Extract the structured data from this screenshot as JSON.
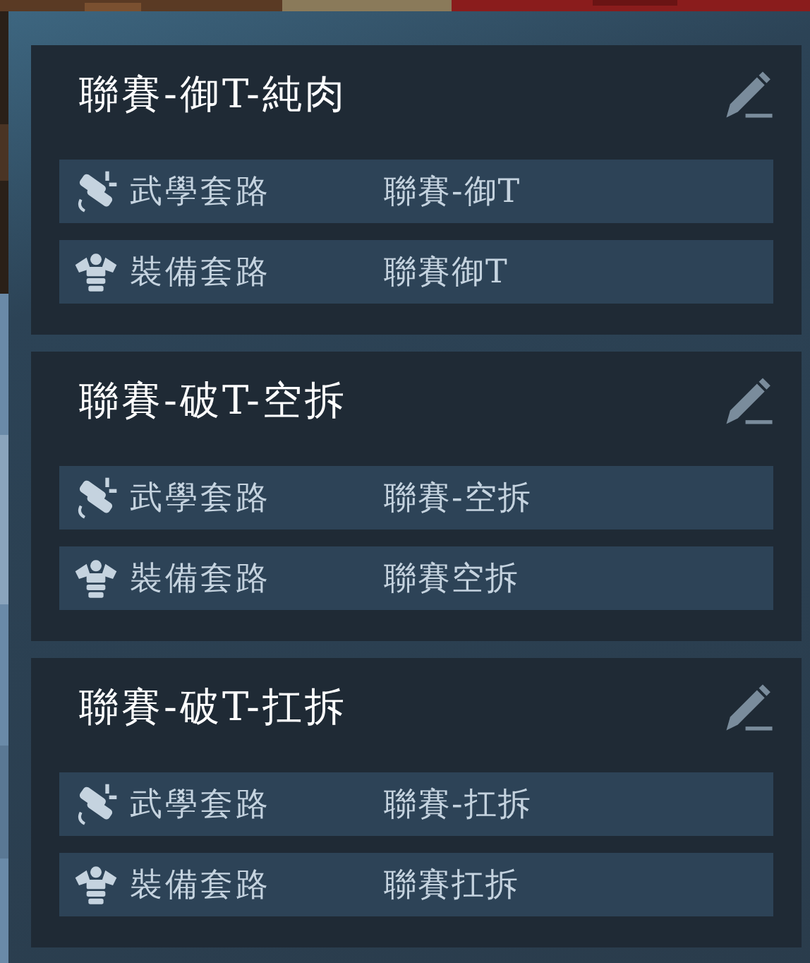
{
  "loadouts": [
    {
      "title": "聯賽-御T-純肉",
      "rows": [
        {
          "kind": "skills",
          "label": "武學套路",
          "value": "聯賽-御T"
        },
        {
          "kind": "gear",
          "label": "裝備套路",
          "value": "聯賽御T"
        }
      ]
    },
    {
      "title": "聯賽-破T-空拆",
      "rows": [
        {
          "kind": "skills",
          "label": "武學套路",
          "value": "聯賽-空拆"
        },
        {
          "kind": "gear",
          "label": "裝備套路",
          "value": "聯賽空拆"
        }
      ]
    },
    {
      "title": "聯賽-破T-扛拆",
      "rows": [
        {
          "kind": "skills",
          "label": "武學套路",
          "value": "聯賽-扛拆"
        },
        {
          "kind": "gear",
          "label": "裝備套路",
          "value": "聯賽扛拆"
        }
      ]
    }
  ]
}
